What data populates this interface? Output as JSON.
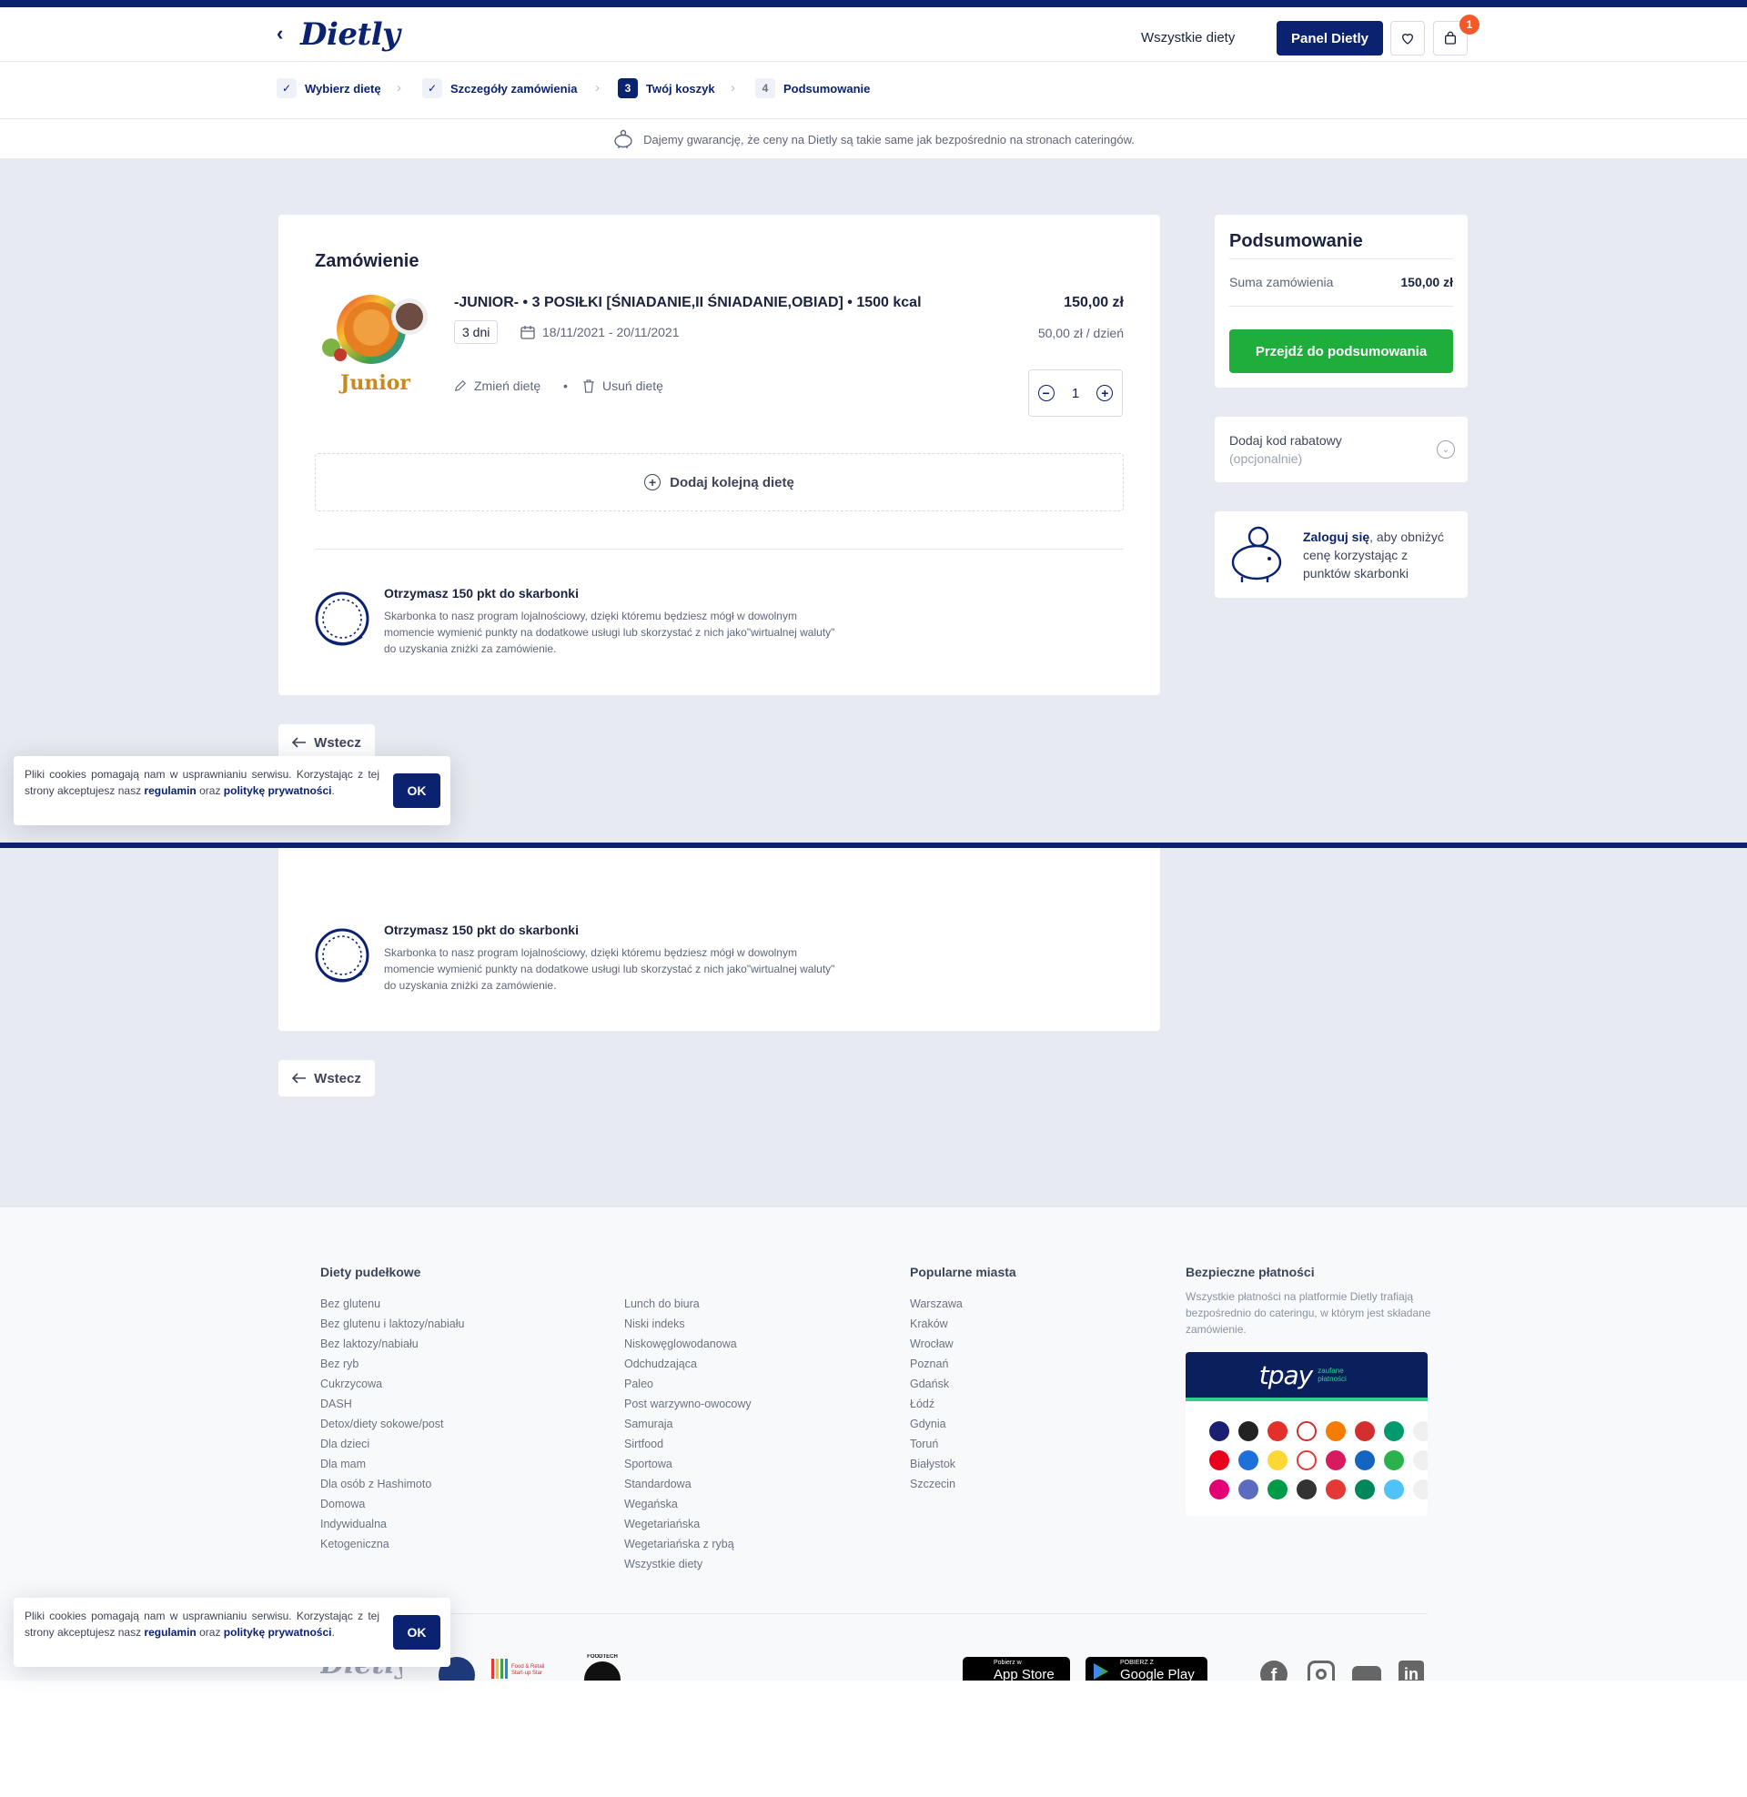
{
  "header": {
    "logo": "Dietly",
    "nav_all": "Wszystkie diety",
    "panel_button": "Panel Dietly",
    "cart_count": "1"
  },
  "steps": [
    {
      "num": "✓",
      "label": "Wybierz dietę",
      "state": "done"
    },
    {
      "num": "✓",
      "label": "Szczegóły zamówienia",
      "state": "done"
    },
    {
      "num": "3",
      "label": "Twój koszyk",
      "state": "current"
    },
    {
      "num": "4",
      "label": "Podsumowanie",
      "state": "todo"
    }
  ],
  "guarantee": "Dajemy gwarancję, że ceny na Dietly są takie same jak bezpośrednio na stronach cateringów.",
  "order": {
    "title": "Zamówienie",
    "image_label": "Junior",
    "diet_name": "-JUNIOR- • 3 POSIŁKI [ŚNIADANIE,II ŚNIADANIE,OBIAD] • 1500 kcal",
    "price": "150,00 zł",
    "days": "3 dni",
    "dates": "18/11/2021 - 20/11/2021",
    "price_per_day": "50,00 zł / dzień",
    "change": "Zmień dietę",
    "remove": "Usuń dietę",
    "quantity": "1",
    "add_another": "Dodaj kolejną dietę"
  },
  "loyalty": {
    "title": "Otrzymasz 150 pkt do skarbonki",
    "text": "Skarbonka to nasz program lojalnościowy, dzięki któremu będziesz mógł w dowolnym momencie wymienić punkty na dodatkowe usługi lub skorzystać z nich jako\"wirtualnej waluty\" do uzyskania zniżki za zamówienie."
  },
  "back_label": "Wstecz",
  "summary": {
    "title": "Podsumowanie",
    "sum_label": "Suma zamówienia",
    "sum_value": "150,00 zł",
    "proceed": "Przejdź do podsumowania"
  },
  "discount": {
    "label": "Dodaj kod rabatowy",
    "optional": "(opcjonalnie)"
  },
  "login_box": {
    "link": "Zaloguj się",
    "text_1": ", aby obniżyć",
    "text_2": "cenę korzystając z",
    "text_3": "punktów skarbonki"
  },
  "cookie": {
    "text_1": "Pliki cookies pomagają nam w usprawnianiu serwisu. Korzystając z tej strony akceptujesz nasz ",
    "link_1": "regulamin",
    "text_2": " oraz ",
    "link_2": "politykę prywatności",
    "text_3": ".",
    "ok": "OK"
  },
  "footer": {
    "col1_title": "Diety pudełkowe",
    "col1": [
      "Bez glutenu",
      "Bez glutenu i laktozy/nabiału",
      "Bez laktozy/nabiału",
      "Bez ryb",
      "Cukrzycowa",
      "DASH",
      "Detox/diety sokowe/post",
      "Dla dzieci",
      "Dla mam",
      "Dla osób z Hashimoto",
      "Domowa",
      "Indywidualna",
      "Ketogeniczna"
    ],
    "col2": [
      "Lunch do biura",
      "Niski indeks",
      "Niskowęglowodanowa",
      "Odchudzająca",
      "Paleo",
      "Post warzywno-owocowy",
      "Samuraja",
      "Sirtfood",
      "Sportowa",
      "Standardowa",
      "Wegańska",
      "Wegetariańska",
      "Wegetariańska z rybą",
      "Wszystkie diety"
    ],
    "col3_title": "Popularne miasta",
    "col3": [
      "Warszawa",
      "Kraków",
      "Wrocław",
      "Poznań",
      "Gdańsk",
      "Łódź",
      "Gdynia",
      "Toruń",
      "Białystok",
      "Szczecin"
    ],
    "col4_title": "Bezpieczne płatności",
    "col4_text": "Wszystkie płatności na platformie Dietly trafiają bezpośrednio do cateringu, w którym jest składane zamówienie.",
    "tpay": "tpay",
    "tpay_sub": "zaufane płatności",
    "appstore_small": "Pobierz w",
    "appstore": "App Store",
    "gplay_small": "POBIERZ Z",
    "gplay": "Google Play",
    "logo": "Dietly",
    "award_1": "Food & Retail Start-up Star",
    "award_2": "FOODTECH"
  },
  "colors": {
    "brand": "#0b2270",
    "green": "#1fae3c",
    "badge": "#f25a2a",
    "bg": "#e7eaf0"
  }
}
